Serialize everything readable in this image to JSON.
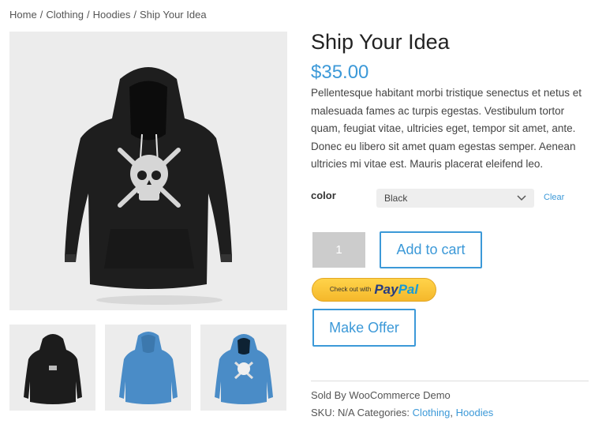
{
  "breadcrumb": {
    "items": [
      "Home",
      "Clothing",
      "Hoodies",
      "Ship Your Idea"
    ],
    "separator": "/"
  },
  "product": {
    "title": "Ship Your Idea",
    "price": "$35.00",
    "description": "Pellentesque habitant morbi tristique senectus et netus et malesuada fames ac turpis egestas. Vestibulum tortor quam, feugiat vitae, ultricies eget, tempor sit amet, ante. Donec eu libero sit amet quam egestas semper. Aenean ultricies mi vitae est. Mauris placerat eleifend leo.",
    "variation": {
      "label": "color",
      "selected": "Black",
      "clear_label": "Clear"
    },
    "quantity": "1",
    "add_to_cart_label": "Add to cart",
    "paypal": {
      "prefix": "Check out with",
      "brand_pay": "Pay",
      "brand_pal": "Pal"
    },
    "make_offer_label": "Make Offer",
    "meta": {
      "sold_by": "Sold By WooCommerce Demo",
      "sku_label": "SKU:",
      "sku_value": "N/A",
      "categories_label": "Categories:",
      "categories": [
        "Clothing",
        "Hoodies"
      ]
    },
    "gallery": {
      "thumbnails": [
        {
          "color": "#1c1c1c",
          "name": "black-hoodie-back"
        },
        {
          "color": "#4a8cc7",
          "name": "blue-hoodie-back"
        },
        {
          "color": "#4a8cc7",
          "name": "blue-hoodie-front"
        }
      ]
    }
  },
  "colors": {
    "accent": "#3c99d8",
    "paypal_yellow": "#ffc439",
    "image_bg": "#ececec"
  }
}
